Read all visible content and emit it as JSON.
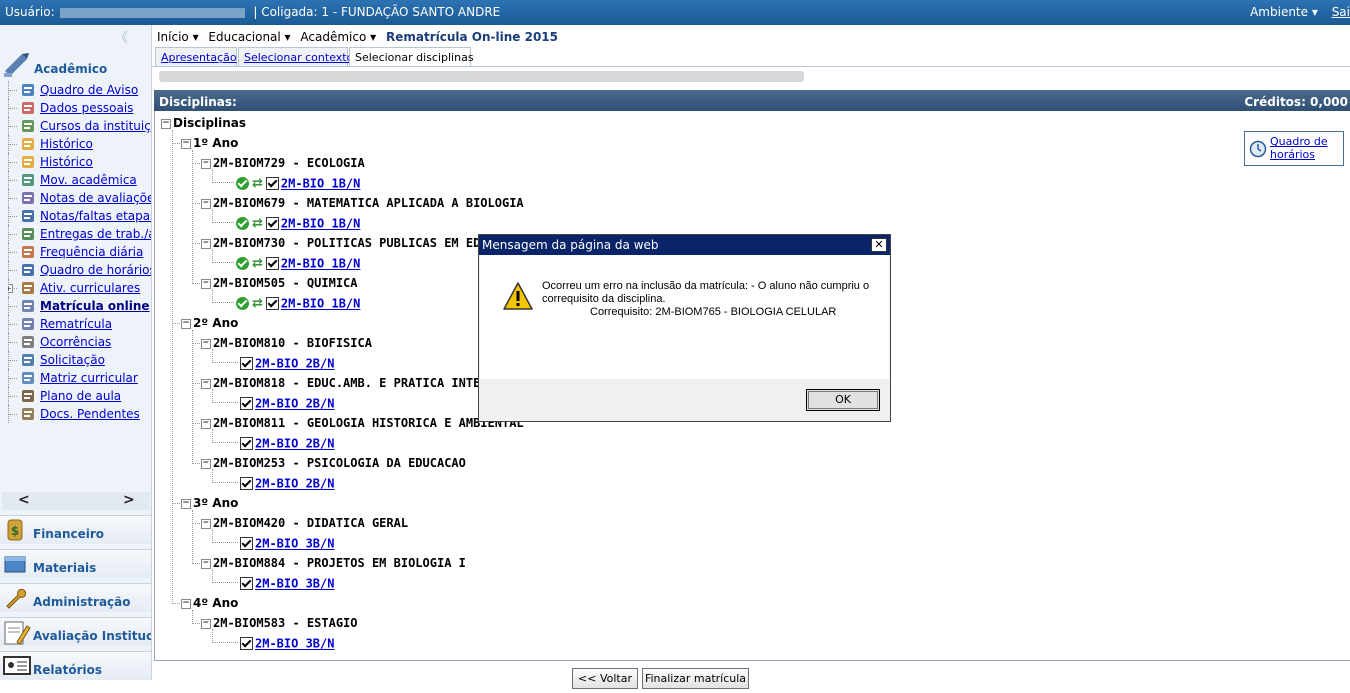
{
  "topbar": {
    "user_label": "Usuário:",
    "coligada": "Coligada: 1 - FUNDAÇÃO SANTO ANDRE",
    "ambiente": "Ambiente ▾",
    "sair": "Sai"
  },
  "sidebar": {
    "collapse": "《",
    "section_title": "Acadêmico",
    "items": [
      {
        "label": "Quadro de Aviso",
        "icon": "notice-icon"
      },
      {
        "label": "Dados pessoais",
        "icon": "user-icon"
      },
      {
        "label": "Cursos da instituição",
        "icon": "check-icon"
      },
      {
        "label": "Histórico",
        "icon": "pencil-icon"
      },
      {
        "label": "Histórico",
        "icon": "pencil-icon"
      },
      {
        "label": "Mov. acadêmica",
        "icon": "arrows-icon"
      },
      {
        "label": "Notas de avaliações",
        "icon": "grades-icon"
      },
      {
        "label": "Notas/faltas etapas",
        "icon": "list-icon"
      },
      {
        "label": "Entregas de trab./av",
        "icon": "delivery-icon"
      },
      {
        "label": "Frequência diária",
        "icon": "calendar-icon"
      },
      {
        "label": "Quadro de horários",
        "icon": "clock-icon"
      },
      {
        "label": "Ativ. curriculares",
        "icon": "activity-icon"
      },
      {
        "label": "Matrícula online",
        "icon": "enroll-icon",
        "bold": true
      },
      {
        "label": "Rematrícula",
        "icon": "reenroll-icon"
      },
      {
        "label": "Ocorrências",
        "icon": "occurrence-icon"
      },
      {
        "label": "Solicitação",
        "icon": "request-icon"
      },
      {
        "label": "Matriz curricular",
        "icon": "matrix-icon"
      },
      {
        "label": "Plano de aula",
        "icon": "book-icon"
      },
      {
        "label": "Docs. Pendentes",
        "icon": "docs-icon"
      }
    ],
    "nav_left": "<",
    "nav_right": ">",
    "sections": [
      "Financeiro",
      "Materiais",
      "Administração",
      "Avaliação Institucional",
      "Relatórios"
    ]
  },
  "breadcrumb": {
    "inicio": "Início ▾",
    "educacional": "Educacional ▾",
    "academico": "Acadêmico ▾",
    "current": "Rematrícula On-line 2015"
  },
  "tabs": [
    "Apresentação",
    "Selecionar contexto",
    "Selecionar disciplinas"
  ],
  "panel": {
    "header_left": "Disciplinas:",
    "header_right": "Créditos: 0,000",
    "root": "Disciplinas",
    "years": [
      {
        "label": "1º Ano",
        "disciplines": [
          {
            "name": "2M-BIOM729 - ECOLOGIA",
            "turma": "2M-BIO 1B/N",
            "status": true
          },
          {
            "name": "2M-BIOM679 - MATEMATICA APLICADA A BIOLOGIA",
            "turma": "2M-BIO 1B/N",
            "status": true
          },
          {
            "name": "2M-BIOM730 - POLITICAS PUBLICAS EM ED",
            "turma": "2M-BIO 1B/N",
            "status": true
          },
          {
            "name": "2M-BIOM505 - QUIMICA",
            "turma": "2M-BIO 1B/N",
            "status": true
          }
        ]
      },
      {
        "label": "2º Ano",
        "disciplines": [
          {
            "name": "2M-BIOM810 - BIOFISICA",
            "turma": "2M-BIO 2B/N"
          },
          {
            "name": "2M-BIOM818 - EDUC.AMB. E PRATICA INTE",
            "turma": "2M-BIO 2B/N"
          },
          {
            "name": "2M-BIOM811 - GEOLOGIA HISTORICA E AMBIENTAL",
            "turma": "2M-BIO 2B/N"
          },
          {
            "name": "2M-BIOM253 - PSICOLOGIA DA EDUCACAO",
            "turma": "2M-BIO 2B/N"
          }
        ]
      },
      {
        "label": "3º Ano",
        "disciplines": [
          {
            "name": "2M-BIOM420 - DIDATICA GERAL",
            "turma": "2M-BIO 3B/N"
          },
          {
            "name": "2M-BIOM884 - PROJETOS EM BIOLOGIA I",
            "turma": "2M-BIO 3B/N"
          }
        ]
      },
      {
        "label": "4º Ano",
        "disciplines": [
          {
            "name": "2M-BIOM583 - ESTAGIO",
            "turma": "2M-BIO 3B/N"
          }
        ]
      }
    ]
  },
  "quadro_link": "Quadro de horários",
  "buttons": {
    "voltar": "<< Voltar",
    "finalizar": "Finalizar matrícula"
  },
  "dialog": {
    "title": "Mensagem da página da web",
    "close": "✕",
    "message": "Ocorreu um erro na inclusão da matrícula: - O aluno não cumpriu o correquisito da disciplina.",
    "requisite": "Correquisito: 2M-BIOM765 - BIOLOGIA CELULAR",
    "ok": "OK"
  }
}
